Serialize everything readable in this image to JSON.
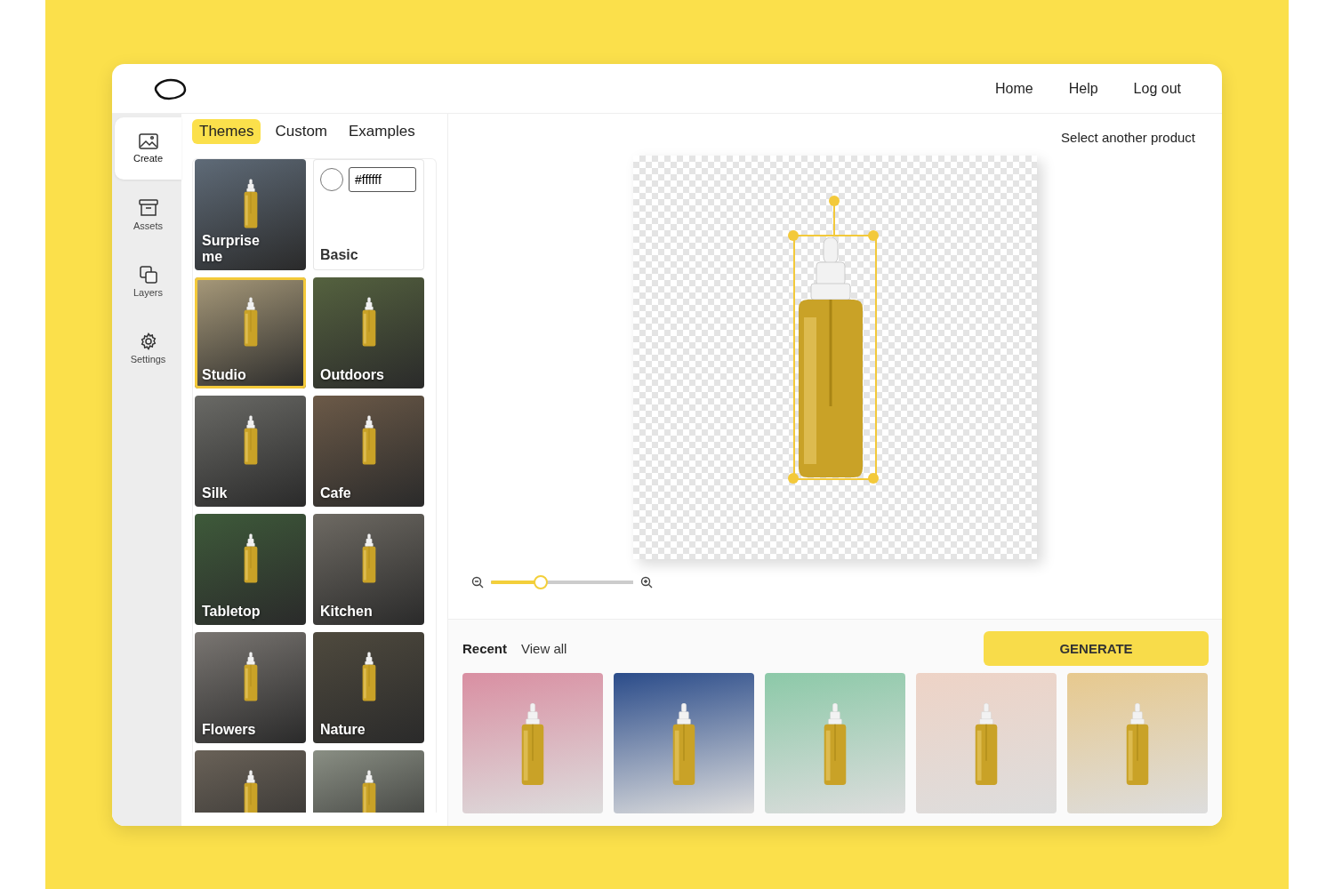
{
  "nav": {
    "links": [
      {
        "label": "Home"
      },
      {
        "label": "Help"
      },
      {
        "label": "Log out"
      }
    ]
  },
  "sidebar": {
    "items": [
      {
        "label": "Create",
        "selected": true
      },
      {
        "label": "Assets",
        "selected": false
      },
      {
        "label": "Layers",
        "selected": false
      },
      {
        "label": "Settings",
        "selected": false
      }
    ]
  },
  "theme_tabs": [
    {
      "label": "Themes",
      "selected": true
    },
    {
      "label": "Custom",
      "selected": false
    },
    {
      "label": "Examples",
      "selected": false
    }
  ],
  "themes": [
    {
      "kind": "photo",
      "label": "Surprise me",
      "selected": false
    },
    {
      "kind": "color",
      "label": "Basic",
      "selected": false
    },
    {
      "kind": "photo",
      "label": "Studio",
      "selected": true
    },
    {
      "kind": "photo",
      "label": "Outdoors",
      "selected": false
    },
    {
      "kind": "photo",
      "label": "Silk",
      "selected": false
    },
    {
      "kind": "photo",
      "label": "Cafe",
      "selected": false
    },
    {
      "kind": "photo",
      "label": "Tabletop",
      "selected": false
    },
    {
      "kind": "photo",
      "label": "Kitchen",
      "selected": false
    },
    {
      "kind": "photo",
      "label": "Flowers",
      "selected": false
    },
    {
      "kind": "photo",
      "label": "Nature",
      "selected": false
    },
    {
      "kind": "photo",
      "selected": false
    },
    {
      "kind": "photo",
      "selected": false
    }
  ],
  "basic_color": {
    "value": "#ffffff"
  },
  "canvas": {
    "select_product": "Select another product",
    "zoom": {
      "level": 0.35
    }
  },
  "recent": {
    "title": "Recent",
    "view_all": "View all",
    "generate": "GENERATE",
    "images": [
      {
        "kind": "photo"
      },
      {
        "kind": "photo"
      },
      {
        "kind": "photo"
      },
      {
        "kind": "photo"
      },
      {
        "kind": "photo"
      }
    ]
  }
}
